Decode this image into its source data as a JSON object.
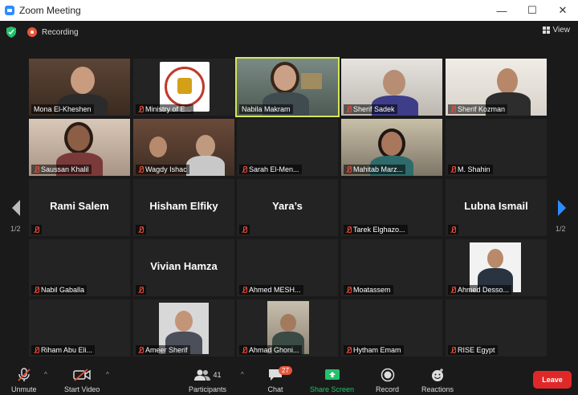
{
  "window": {
    "title": "Zoom Meeting",
    "minimize": "—",
    "maximize": "☐",
    "close": "✕"
  },
  "topbar": {
    "recording_label": "Recording",
    "view_label": "View"
  },
  "pagination": {
    "left_page": "1/2",
    "right_page": "1/2"
  },
  "participants": [
    {
      "name": "Mona El-Kheshen",
      "muted": false,
      "big_name": ""
    },
    {
      "name": "Ministry of E...",
      "muted": true,
      "big_name": ""
    },
    {
      "name": "Nabila Makram",
      "muted": false,
      "big_name": ""
    },
    {
      "name": "Sherif Sadek",
      "muted": true,
      "big_name": ""
    },
    {
      "name": "Sherif Kozman",
      "muted": true,
      "big_name": ""
    },
    {
      "name": "Saussan Khalil",
      "muted": true,
      "big_name": ""
    },
    {
      "name": "Wagdy Ishac",
      "muted": true,
      "big_name": ""
    },
    {
      "name": "Sarah El-Men...",
      "muted": true,
      "big_name": ""
    },
    {
      "name": "Mahitab Marz...",
      "muted": true,
      "big_name": ""
    },
    {
      "name": "M. Shahin",
      "muted": true,
      "big_name": ""
    },
    {
      "name": "",
      "muted": true,
      "big_name": "Rami Salem"
    },
    {
      "name": "",
      "muted": true,
      "big_name": "Hisham Elfiky"
    },
    {
      "name": "",
      "muted": true,
      "big_name": "Yara’s"
    },
    {
      "name": "Tarek Elghazo...",
      "muted": true,
      "big_name": ""
    },
    {
      "name": "",
      "muted": true,
      "big_name": "Lubna Ismail"
    },
    {
      "name": "Nabil Gaballa",
      "muted": true,
      "big_name": ""
    },
    {
      "name": "",
      "muted": true,
      "big_name": "Vivian Hamza"
    },
    {
      "name": "Ahmed MESH...",
      "muted": true,
      "big_name": ""
    },
    {
      "name": "Moatassem",
      "muted": true,
      "big_name": ""
    },
    {
      "name": "Ahmed Desso...",
      "muted": true,
      "big_name": ""
    },
    {
      "name": "Riham Abu Eli...",
      "muted": true,
      "big_name": ""
    },
    {
      "name": "Ameer Sherif",
      "muted": true,
      "big_name": ""
    },
    {
      "name": "Ahmad Ghoni...",
      "muted": true,
      "big_name": ""
    },
    {
      "name": "Hytham Emam",
      "muted": true,
      "big_name": ""
    },
    {
      "name": "RISE Egypt",
      "muted": true,
      "big_name": ""
    }
  ],
  "toolbar": {
    "unmute": "Unmute",
    "start_video": "Start Video",
    "participants": "Participants",
    "participants_count": "41",
    "chat": "Chat",
    "chat_badge": "27",
    "share_screen": "Share Screen",
    "record": "Record",
    "reactions": "Reactions",
    "leave": "Leave"
  },
  "colors": {
    "active_speaker": "#d6e65a",
    "share_green": "#23c16b",
    "leave_red": "#e02828",
    "muted_red": "#e74c3c"
  }
}
